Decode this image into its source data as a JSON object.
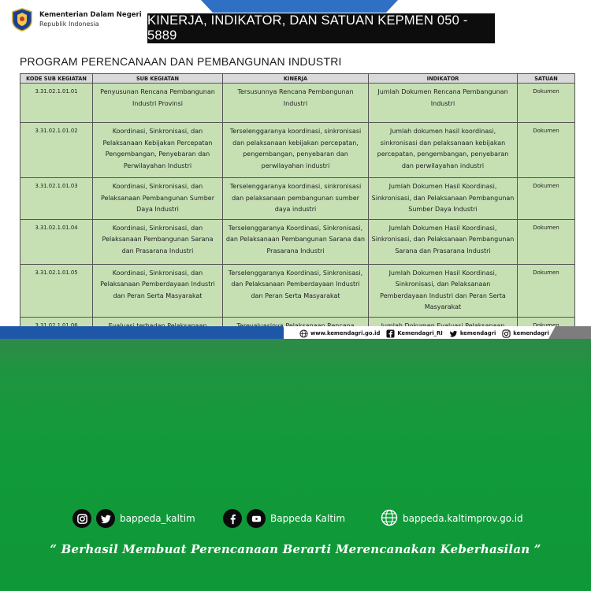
{
  "header": {
    "org_name": "Kementerian Dalam Negeri",
    "org_sub": "Republik Indonesia",
    "title": "KINERJA, INDIKATOR, DAN SATUAN KEPMEN 050 - 5889"
  },
  "program": {
    "title": "PROGRAM PERENCANAAN DAN PEMBANGUNAN INDUSTRI"
  },
  "table": {
    "columns": [
      "KODE SUB KEGIATAN",
      "SUB KEGIATAN",
      "KINERJA",
      "INDIKATOR",
      "SATUAN"
    ],
    "rows": [
      {
        "kode": "3.31.02.1.01.01",
        "sub": "Penyusunan Rencana Pembangunan Industri Provinsi",
        "kinerja": "Tersusunnya Rencana Pembangunan Industri",
        "indikator": "Jumlah Dokumen Rencana Pembangunan Industri",
        "satuan": "Dokumen"
      },
      {
        "kode": "3.31.02.1.01.02",
        "sub": "Koordinasi, Sinkronisasi, dan Pelaksanaan Kebijakan Percepatan Pengembangan, Penyebaran dan Perwilayahan Industri",
        "kinerja": "Terselenggaranya koordinasi, sinkronisasi dan pelaksanaan kebijakan percepatan, pengembangan, penyebaran dan perwilayahan industri",
        "indikator": "Jumlah dokumen hasil koordinasi, sinkronisasi dan pelaksanaan kebijakan percepatan, pengembangan, penyebaran dan perwilayahan industri",
        "satuan": "Dokumen"
      },
      {
        "kode": "3.31.02.1.01.03",
        "sub": "Koordinasi, Sinkronisasi, dan Pelaksanaan Pembangunan Sumber Daya Industri",
        "kinerja": "Terselenggaranya koordinasi, sinkronisasi dan pelaksanaan pembangunan sumber daya industri",
        "indikator": "Jumlah Dokumen Hasil Koordinasi, Sinkronisasi, dan Pelaksanaan Pembangunan Sumber Daya Industri",
        "satuan": "Dokumen"
      },
      {
        "kode": "3.31.02.1.01.04",
        "sub": "Koordinasi, Sinkronisasi, dan Pelaksanaan Pembangunan Sarana dan Prasarana Industri",
        "kinerja": "Terselenggaranya Koordinasi, Sinkronisasi, dan Pelaksanaan Pembangunan Sarana dan Prasarana Industri",
        "indikator": "Jumlah Dokumen Hasil Koordinasi, Sinkronisasi, dan Pelaksanaan Pembangunan Sarana dan Prasarana Industri",
        "satuan": "Dokumen"
      },
      {
        "kode": "3.31.02.1.01.05",
        "sub": "Koordinasi, Sinkronisasi, dan Pelaksanaan Pemberdayaan Industri dan Peran Serta Masyarakat",
        "kinerja": "Terselenggaranya Koordinasi, Sinkronisasi, dan Pelaksanaan Pemberdayaan Industri dan Peran Serta Masyarakat",
        "indikator": "Jumlah Dokumen Hasil Koordinasi, Sinkronisasi, dan Pelaksanaan Pemberdayaan Industri dan Peran Serta Masyarakat",
        "satuan": "Dokumen"
      },
      {
        "kode": "3.31.02.1.01.06",
        "sub": "Evaluasi terhadap Pelaksanaan Rencana Pembangunan Industri",
        "kinerja": "Terevaluasinya Pelaksanaan Rencana Pembangunan Industri",
        "indikator": "Jumlah Dokumen Evaluasi Pelaksanaan Rencana Pembangunan Industri",
        "satuan": "Dokumen"
      }
    ]
  },
  "slide_footer": {
    "website": "www.kemendagri.go.id",
    "facebook": "Kemendagri_RI",
    "twitter": "kemendagri",
    "instagram": "kemendagri"
  },
  "social": {
    "handle": "bappeda_kaltim",
    "page": "Bappeda Kaltim",
    "website": "bappeda.kaltimprov.go.id"
  },
  "tagline": "“ Berhasil  Membuat Perencanaan Berarti Merencanakan Keberhasilan ”",
  "colors": {
    "table_header": "#d9d9d9",
    "table_cell": "#c6e0b4",
    "title_box": "#0d0d0d",
    "brand_blue": "#1f57a8",
    "green_panel": "#129a3a"
  }
}
